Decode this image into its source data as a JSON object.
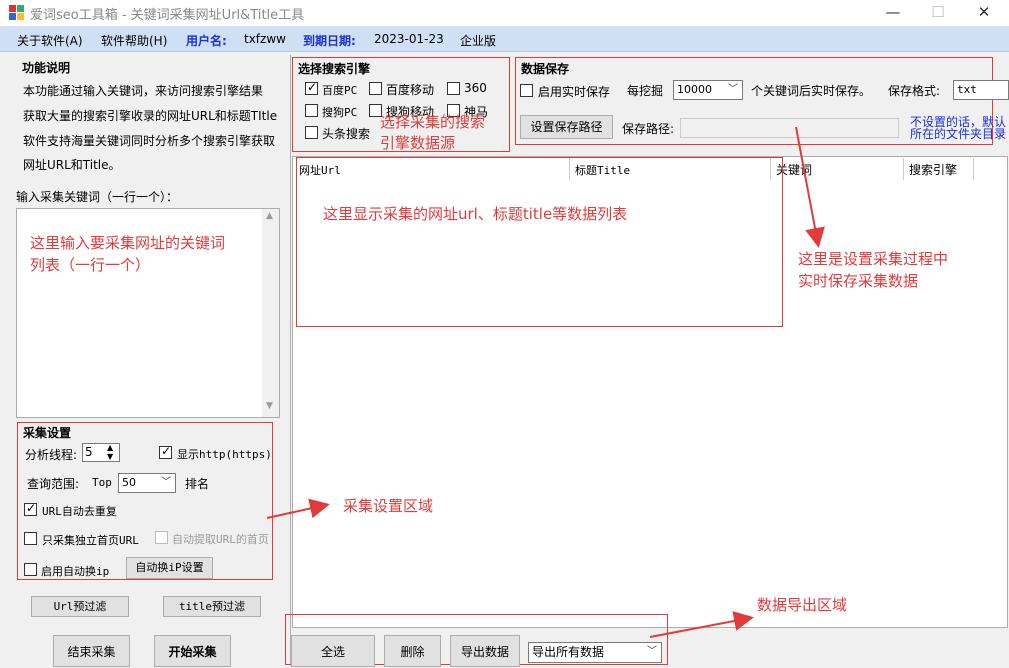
{
  "window": {
    "title": "爱词seo工具箱 - 关键词采集网址Url&Title工具",
    "min": "—",
    "max": "☐",
    "close": "✕"
  },
  "menu": {
    "about": "关于软件(A)",
    "help": "软件帮助(H)",
    "username_label": "用户名:",
    "username": "txfzww",
    "expiry_label": "到期日期:",
    "expiry": "2023-01-23",
    "edition": "企业版"
  },
  "intro": {
    "heading": "功能说明",
    "lines": [
      "本功能通过输入关键词，来访问搜索引擎结果",
      "获取大量的搜索引擎收录的网址URL和标题TItle",
      "软件支持海量关键词同时分析多个搜索引擎获取",
      "网址URL和Title。"
    ]
  },
  "keywords": {
    "label": "输入采集关键词（一行一个）："
  },
  "collect": {
    "heading": "采集设置",
    "threads_label": "分析线程:",
    "threads": "5",
    "show_http": "显示http(https)",
    "range_label": "查询范围:",
    "top_label": "Top",
    "top_value": "50",
    "rank_label": "排名",
    "dedupe": "URL自动去重复",
    "homepage_only": "只采集独立首页URL",
    "auto_extract_home": "自动提取URL的首页",
    "auto_ip": "启用自动换ip",
    "auto_ip_settings": "自动换iP设置"
  },
  "filters": {
    "url": "Url预过滤",
    "title": "title预过滤"
  },
  "actions": {
    "stop": "结束采集",
    "start": "开始采集"
  },
  "engines": {
    "heading": "选择搜索引擎",
    "items": [
      "百度PC",
      "百度移动",
      "360",
      "搜狗PC",
      "搜狗移动",
      "神马",
      "头条搜索"
    ]
  },
  "save": {
    "heading": "数据保存",
    "realtime": "启用实时保存",
    "every_label": "每挖掘",
    "every_value": "10000",
    "after_label": "个关键词后实时保存。",
    "format_label": "保存格式:",
    "format_value": "txt",
    "set_path": "设置保存路径",
    "path_label": "保存路径:",
    "hint_line1": "不设置的话，默认",
    "hint_line2": "所在的文件夹目录"
  },
  "table": {
    "columns": [
      "网址Url",
      "标题Title",
      "关键词",
      "搜索引擎"
    ]
  },
  "bottom": {
    "select_all": "全选",
    "delete": "删除",
    "export": "导出数据",
    "export_option": "导出所有数据"
  },
  "annotations": {
    "engines": "选择采集的搜索\n引擎数据源",
    "table": "这里显示采集的网址url、标题title等数据列表",
    "keywords": "这里输入要采集网址的关键词\n列表（一行一个）",
    "save": "这里是设置采集过程中\n实时保存采集数据",
    "settings": "采集设置区域",
    "export": "数据导出区域"
  },
  "colors": {
    "annotation": "#e23b3b",
    "menubar": "#cfe0f5",
    "label_blue": "#1a30d8"
  }
}
